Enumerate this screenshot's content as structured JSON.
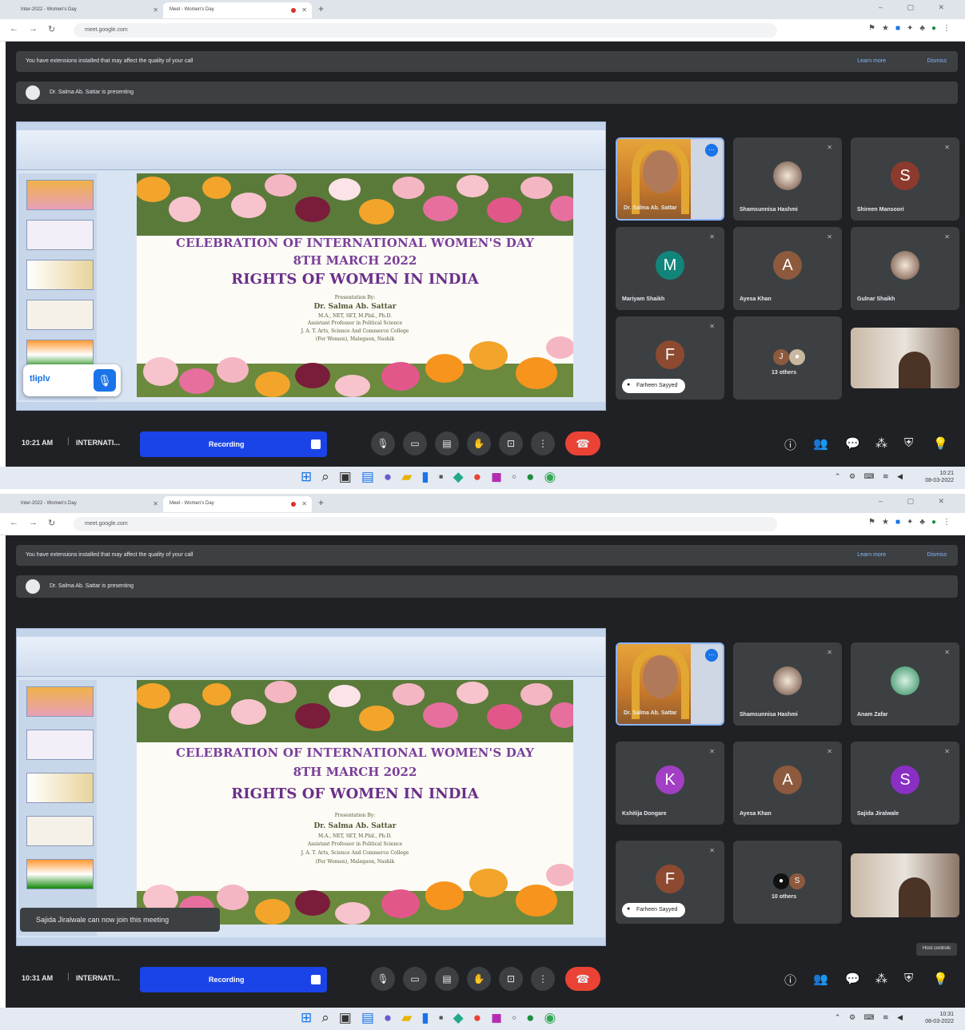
{
  "browser": {
    "tab1_title": "Inter-2022 - Women's Day",
    "tab2_title": "Meet - Women's Day",
    "new_tab": "+",
    "url": "meet.google.com",
    "window_controls": "–  ▢  ✕"
  },
  "meet": {
    "extensions_banner": "You have extensions installed that may affect the quality of your call",
    "learn_more": "Learn more",
    "dismiss": "Dismiss",
    "presenting_text": "Dr. Salma Ab. Sattar is presenting"
  },
  "slide": {
    "title": "CELEBRATION OF INTERNATIONAL WOMEN'S DAY",
    "date": "8TH MARCH 2022",
    "subtitle": "RIGHTS OF WOMEN IN INDIA",
    "presented_by": "Presentation By:",
    "presenter": "Dr. Salma Ab. Sattar",
    "credentials": "M.A., NET, SET, M.Phil., Ph.D.",
    "position": "Assistant Professor in Political Science",
    "college": "J. A. T. Arts, Science And Commerce College",
    "location": "(For Women), Malegaon, Nashik"
  },
  "mini_presentation_label": "tlɨplv",
  "toast_text": "Sajida Jiralwale can now join this meeting",
  "shot1": {
    "participants": [
      {
        "name": "Dr. Salma Ab. Sattar",
        "type": "video"
      },
      {
        "name": "Shamsunnisa Hashmi",
        "type": "photo"
      },
      {
        "name": "Shireen Mansoori",
        "type": "avatar",
        "initial": "S",
        "color": "#8d3a2e"
      },
      {
        "name": "Mariyam Shaikh",
        "type": "avatar",
        "initial": "M",
        "color": "#12857a"
      },
      {
        "name": "Ayesa Khan",
        "type": "avatar",
        "initial": "A",
        "color": "#8d5a3e"
      },
      {
        "name": "Gulnar Shaikh",
        "type": "photo"
      },
      {
        "name": "Farheen Sayyed",
        "type": "avatar-pill",
        "initial": "F",
        "color": "#8d4a30"
      },
      {
        "name": "13 others",
        "type": "others"
      },
      {
        "name": "",
        "type": "camera"
      }
    ],
    "time": "10:21 AM",
    "meeting_title": "INTERNATI...",
    "recording": "Recording",
    "taskbar_time": "10:21",
    "taskbar_date": "08-03-2022"
  },
  "shot2": {
    "participants": [
      {
        "name": "Dr. Salma Ab. Sattar",
        "type": "video"
      },
      {
        "name": "Shamsunnisa Hashmi",
        "type": "photo"
      },
      {
        "name": "Anam Zafar",
        "type": "photo2"
      },
      {
        "name": "Kshitija Dongare",
        "type": "avatar",
        "initial": "K",
        "color": "#a23fc4"
      },
      {
        "name": "Ayesa Khan",
        "type": "avatar",
        "initial": "A",
        "color": "#8d5a3e"
      },
      {
        "name": "Sajida Jiralwale",
        "type": "avatar",
        "initial": "S",
        "color": "#8a2fc4"
      },
      {
        "name": "Farheen Sayyed",
        "type": "avatar-pill",
        "initial": "F",
        "color": "#8d4a30"
      },
      {
        "name": "10 others",
        "type": "others"
      },
      {
        "name": "",
        "type": "camera"
      }
    ],
    "time": "10:31 AM",
    "meeting_title": "INTERNATI...",
    "recording": "Recording",
    "tooltip": "Host controls",
    "taskbar_time": "10:31",
    "taskbar_date": "08-03-2022"
  },
  "icons": {
    "mic": "🎙",
    "camera": "▭",
    "captions": "▤",
    "raise_hand": "✋",
    "present": "⊡",
    "more": "⋮",
    "end_call": "☎",
    "info": "ⓘ",
    "people": "👥",
    "chat": "💬",
    "activities": "⁂",
    "host": "⛨",
    "lightbulb": "💡"
  },
  "colors": {
    "meet_bg": "#202124",
    "tile_bg": "#3c4043",
    "recording_blue": "#1a44e8",
    "end_red": "#ea4335",
    "slide_purple": "#7a3f9a"
  }
}
